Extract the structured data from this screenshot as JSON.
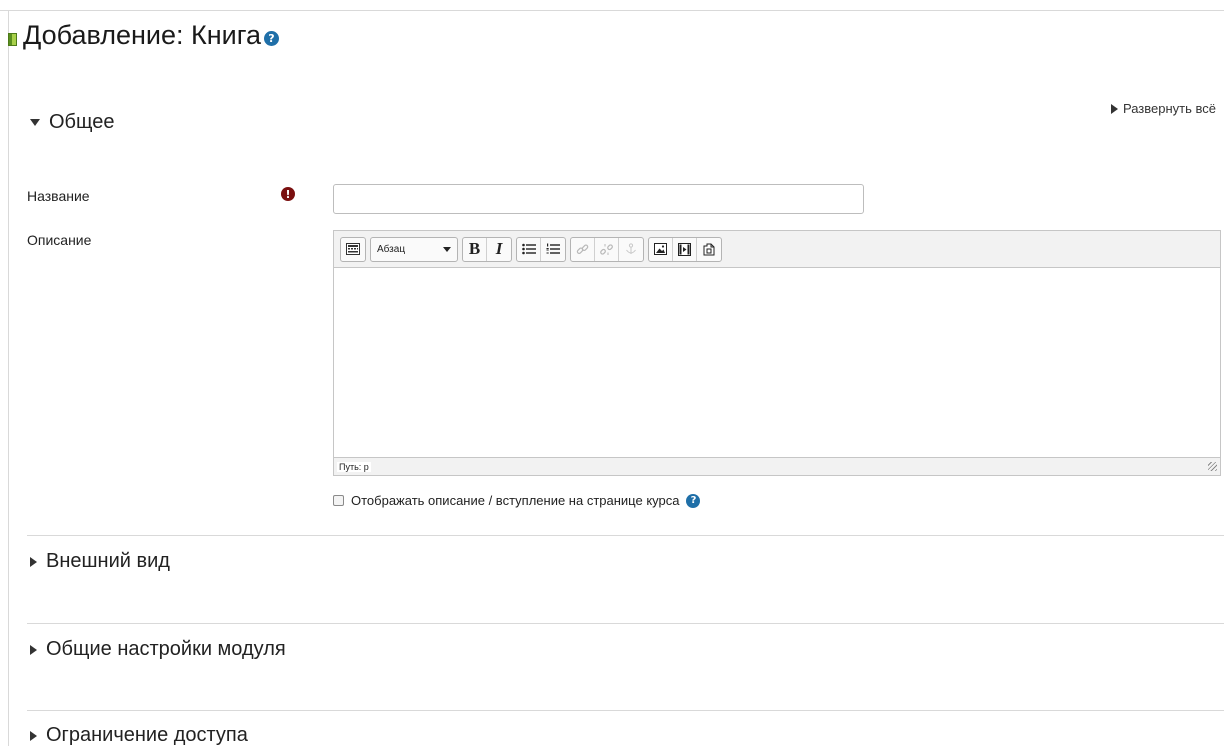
{
  "page": {
    "title": "Добавление: Книга",
    "expand_all_label": "Развернуть всё"
  },
  "sections": {
    "general": {
      "label": "Общее",
      "expanded": true
    },
    "appearance": {
      "label": "Внешний вид",
      "expanded": false
    },
    "module_settings": {
      "label": "Общие настройки модуля",
      "expanded": false
    },
    "access": {
      "label": "Ограничение доступа",
      "expanded": false
    }
  },
  "form": {
    "name_label": "Название",
    "name_value": "",
    "required_icon": "!",
    "description_label": "Описание",
    "format_value": "Абзац",
    "editor_path": "Путь: p",
    "show_description_label": "Отображать описание / вступление на странице курса",
    "show_description_checked": false,
    "help_icon": "?"
  },
  "toolbar": {
    "bold_label": "B",
    "italic_label": "I",
    "icons": [
      "toggle-toolbar-icon",
      "unordered-list-icon",
      "ordered-list-icon",
      "link-icon",
      "unlink-icon",
      "anchor-icon",
      "image-icon",
      "media-icon",
      "manage-files-icon"
    ]
  },
  "colors": {
    "help_blue": "#1f6fa8",
    "required_red": "#7a0f0f",
    "book_green": "#7fb13a"
  }
}
